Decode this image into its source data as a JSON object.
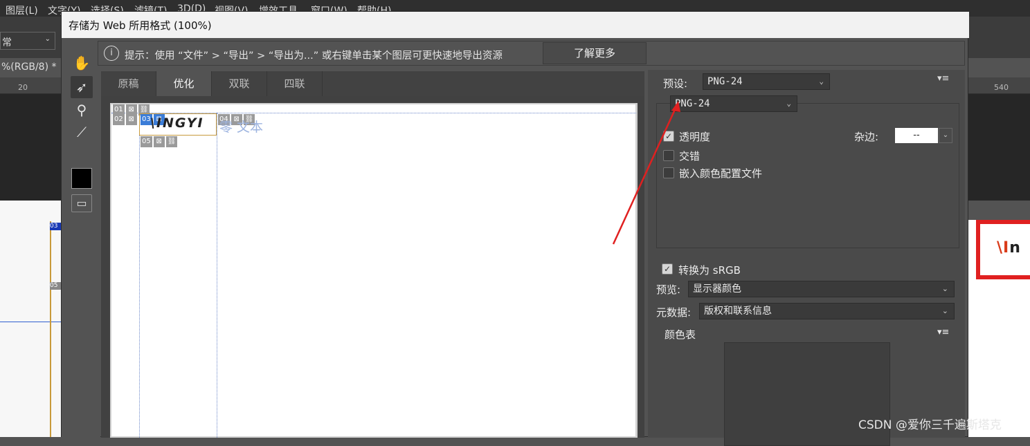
{
  "menubar": {
    "items": [
      "图层(L)",
      "文字(Y)",
      "选择(S)",
      "滤镜(T)",
      "3D(D)",
      "视图(V)",
      "增效工具",
      "窗口(W)",
      "帮助(H)"
    ]
  },
  "options": {
    "mode_value": "常"
  },
  "document": {
    "tab_label": "%(RGB/8) *"
  },
  "ruler": {
    "ticks": [
      "20",
      "540"
    ]
  },
  "background_badges": {
    "b1": "03",
    "b2": "05"
  },
  "background_logo": {
    "text": "\\In"
  },
  "dialog": {
    "title": "存储为 Web 所用格式 (100%)",
    "info": {
      "icon": "info-icon",
      "text": "提示：使用 “文件” > “导出” > “导出为...” 或右键单击某个图层可更快速地导出资源",
      "learn_more": "了解更多"
    },
    "tools": [
      "hand-icon",
      "slice-select-icon",
      "zoom-icon",
      "eyedropper-icon"
    ],
    "tabs": [
      "原稿",
      "优化",
      "双联",
      "四联"
    ],
    "active_tab": "优化",
    "preview": {
      "slices": {
        "s01": "01",
        "s02": "02",
        "s03": "03",
        "s04": "04",
        "s05": "05"
      },
      "logo_text": "\\INGYI",
      "text_after_logo": "零 文本"
    },
    "settings": {
      "preset_label": "预设:",
      "preset_value": "PNG-24",
      "format_value": "PNG-24",
      "transparency": {
        "label": "透明度",
        "checked": true
      },
      "interlaced": {
        "label": "交错",
        "checked": false
      },
      "embed_profile": {
        "label": "嵌入颜色配置文件",
        "checked": false
      },
      "matte_label": "杂边:",
      "matte_value": "--",
      "convert_srgb": {
        "label": "转换为 sRGB",
        "checked": true
      },
      "preview_label": "预览:",
      "preview_value": "显示器颜色",
      "metadata_label": "元数据:",
      "metadata_value": "版权和联系信息",
      "color_table_label": "颜色表"
    }
  },
  "watermark": "CSDN @爱你三千遍斯塔克",
  "colors": {
    "annotation_arrow": "#e02020",
    "accent": "#3b7dd8"
  }
}
